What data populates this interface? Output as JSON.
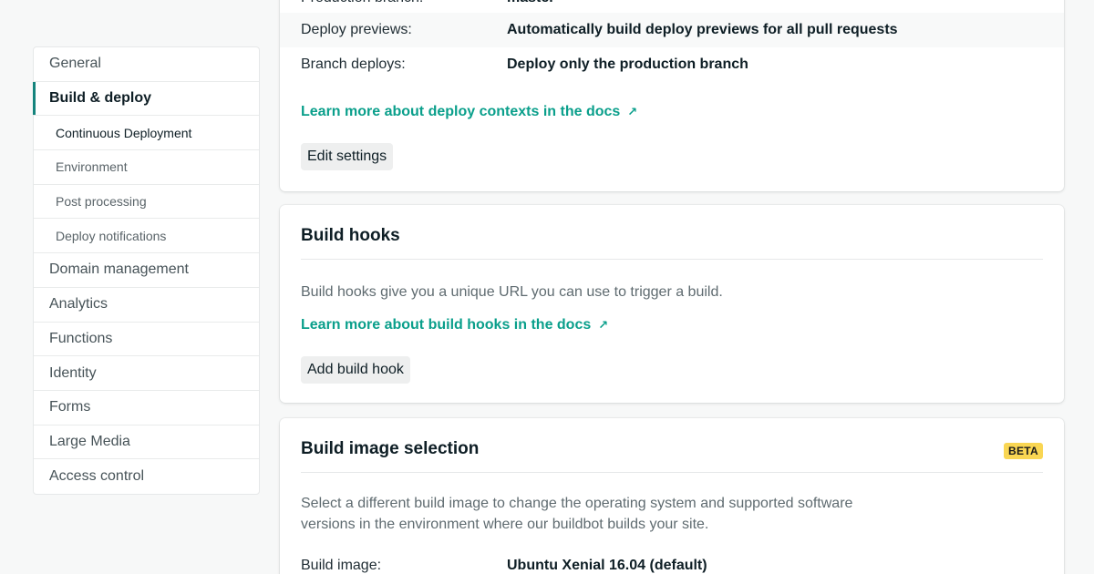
{
  "sidebar": {
    "items": [
      {
        "label": "General"
      },
      {
        "label": "Build & deploy"
      },
      {
        "label": "Continuous Deployment"
      },
      {
        "label": "Environment"
      },
      {
        "label": "Post processing"
      },
      {
        "label": "Deploy notifications"
      },
      {
        "label": "Domain management"
      },
      {
        "label": "Analytics"
      },
      {
        "label": "Functions"
      },
      {
        "label": "Identity"
      },
      {
        "label": "Forms"
      },
      {
        "label": "Large Media"
      },
      {
        "label": "Access control"
      }
    ]
  },
  "deploy_contexts": {
    "rows": [
      {
        "key": "Production branch:",
        "value": "master"
      },
      {
        "key": "Deploy previews:",
        "value": "Automatically build deploy previews for all pull requests"
      },
      {
        "key": "Branch deploys:",
        "value": "Deploy only the production branch"
      }
    ],
    "docs_link": "Learn more about deploy contexts in the docs",
    "edit_button": "Edit settings"
  },
  "build_hooks": {
    "title": "Build hooks",
    "description": "Build hooks give you a unique URL you can use to trigger a build.",
    "docs_link": "Learn more about build hooks in the docs",
    "add_button": "Add build hook"
  },
  "build_image": {
    "title": "Build image selection",
    "badge": "BETA",
    "description_line1": "Select a different build image to change the operating system and supported software",
    "description_line2": "versions in the environment where our buildbot builds your site.",
    "row": {
      "key": "Build image:",
      "value": "Ubuntu Xenial 16.04 (default)"
    }
  },
  "icons": {
    "external_link": "arrow-up-right-icon"
  },
  "colors": {
    "accent": "#15847d",
    "link": "#0a9f8b",
    "badge": "#f9d653"
  }
}
